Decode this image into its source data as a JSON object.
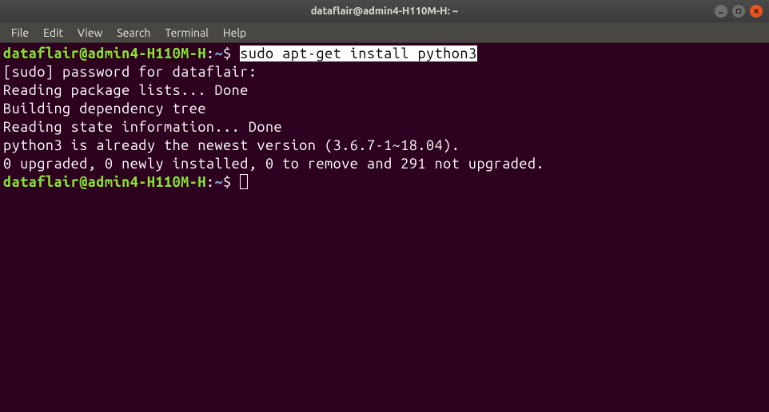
{
  "window": {
    "title": "dataflair@admin4-H110M-H: ~"
  },
  "menubar": {
    "file": "File",
    "edit": "Edit",
    "view": "View",
    "search": "Search",
    "terminal": "Terminal",
    "help": "Help"
  },
  "terminal": {
    "prompt_user": "dataflair@admin4-H110M-H",
    "prompt_sep": ":",
    "prompt_path": "~",
    "prompt_symbol": "$ ",
    "command1": "sudo apt-get install python3",
    "line1": "[sudo] password for dataflair: ",
    "line2": "Reading package lists... Done",
    "line3": "Building dependency tree       ",
    "line4": "Reading state information... Done",
    "line5": "python3 is already the newest version (3.6.7-1~18.04).",
    "line6": "0 upgraded, 0 newly installed, 0 to remove and 291 not upgraded."
  }
}
